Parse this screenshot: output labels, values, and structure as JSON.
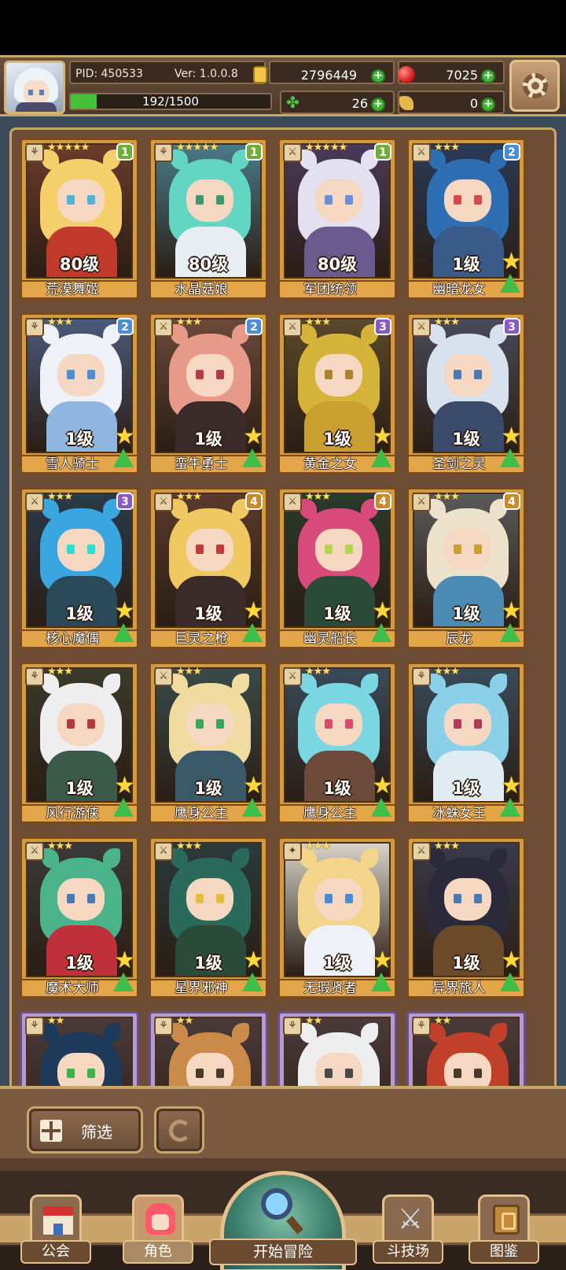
{
  "header": {
    "pid": "PID: 450533",
    "version": "Ver: 1.0.0.8",
    "gold": "2796449",
    "gems": "7025",
    "stamina": "192/1500",
    "stamina_fraction": 0.128,
    "clovers": "26",
    "scrolls": "0",
    "colors": {
      "panel": "#3a2a1f",
      "accent": "#c9a56b",
      "plus": "#45b43a"
    }
  },
  "heroes": [
    {
      "name": "荒漠舞姬",
      "level": "80级",
      "stars": "★★★★★",
      "rank": "1",
      "rank_color": "#6fae3a",
      "hair": "#f4cf6a",
      "eyes": "#4fb2d6",
      "outfit": "#c0392b",
      "bg": "#6b3b2a",
      "slot": "⚘",
      "show_up": false
    },
    {
      "name": "水晶菇娘",
      "level": "80级",
      "stars": "★★★★★",
      "rank": "1",
      "rank_color": "#6fae3a",
      "hair": "#62d6c2",
      "eyes": "#3c9a6a",
      "outfit": "#e6eef2",
      "bg": "#4a7a8a",
      "slot": "⚘",
      "show_up": false
    },
    {
      "name": "军团统领",
      "level": "80级",
      "stars": "★★★★★",
      "rank": "1",
      "rank_color": "#6fae3a",
      "hair": "#e3e0f0",
      "eyes": "#6b8fd6",
      "outfit": "#6b5a8e",
      "bg": "#4a3a5a",
      "slot": "⚔",
      "show_up": false
    },
    {
      "name": "幽暗龙女",
      "level": "1级",
      "stars": "★★★",
      "rank": "2",
      "rank_color": "#4a8fd6",
      "hair": "#2e6fb3",
      "eyes": "#d64a4a",
      "outfit": "#3a5a8a",
      "bg": "#2a3a5a",
      "slot": "⚔",
      "show_up": true
    },
    {
      "name": "雪人骑士",
      "level": "1级",
      "stars": "★★★",
      "rank": "2",
      "rank_color": "#4a8fd6",
      "hair": "#eef2f8",
      "eyes": "#4a8fd6",
      "outfit": "#8fb6e0",
      "bg": "#4a5a7a",
      "slot": "⚘",
      "show_up": true
    },
    {
      "name": "蛮牛勇士",
      "level": "1级",
      "stars": "★★★",
      "rank": "2",
      "rank_color": "#4a8fd6",
      "hair": "#e89a8a",
      "eyes": "#b33a4a",
      "outfit": "#3a2a2a",
      "bg": "#6b4a3a",
      "slot": "⚔",
      "show_up": true
    },
    {
      "name": "黄金之女",
      "level": "1级",
      "stars": "★★★",
      "rank": "3",
      "rank_color": "#8a5ac0",
      "hair": "#d6b43a",
      "eyes": "#a8842a",
      "outfit": "#c9a030",
      "bg": "#5a4a2a",
      "slot": "⚔",
      "show_up": true
    },
    {
      "name": "圣剑之灵",
      "level": "1级",
      "stars": "★★★",
      "rank": "3",
      "rank_color": "#8a5ac0",
      "hair": "#d8e2ee",
      "eyes": "#4a7ab3",
      "outfit": "#3a4a6a",
      "bg": "#4a4a5a",
      "slot": "⚔",
      "show_up": true
    },
    {
      "name": "核心魔偶",
      "level": "1级",
      "stars": "★★★",
      "rank": "3",
      "rank_color": "#8a5ac0",
      "hair": "#3aa6e0",
      "eyes": "#2ae0d6",
      "outfit": "#2a4a5a",
      "bg": "#2a3a4a",
      "slot": "⚔",
      "show_up": true
    },
    {
      "name": "巨灵之枪",
      "level": "1级",
      "stars": "★★★",
      "rank": "4",
      "rank_color": "#c98a2a",
      "hair": "#f0c862",
      "eyes": "#c03a3a",
      "outfit": "#3a2a2a",
      "bg": "#5a3a2a",
      "slot": "⚔",
      "show_up": true
    },
    {
      "name": "幽灵船长",
      "level": "1级",
      "stars": "★★★",
      "rank": "4",
      "rank_color": "#c98a2a",
      "hair": "#d84a7a",
      "eyes": "#b3d64a",
      "outfit": "#2a4a3a",
      "bg": "#2a3a2a",
      "slot": "⚔",
      "show_up": true
    },
    {
      "name": "辰龙",
      "level": "1级",
      "stars": "★★★",
      "rank": "4",
      "rank_color": "#c98a2a",
      "hair": "#ece2cc",
      "eyes": "#c9a030",
      "outfit": "#4a8ab3",
      "bg": "#5a5a5a",
      "slot": "⚔",
      "show_up": true
    },
    {
      "name": "风行游侠",
      "level": "1级",
      "stars": "★★★",
      "rank": "",
      "rank_color": "",
      "hair": "#eeeeee",
      "eyes": "#b33a3a",
      "outfit": "#3a5a4a",
      "bg": "#3a3a2a",
      "slot": "⚘",
      "show_up": true
    },
    {
      "name": "鹰身公主",
      "level": "1级",
      "stars": "★★★",
      "rank": "",
      "rank_color": "",
      "hair": "#f0dca0",
      "eyes": "#3aa65a",
      "outfit": "#3a5a6a",
      "bg": "#3a4a4a",
      "slot": "⚔",
      "show_up": true
    },
    {
      "name": "鹰身公主",
      "level": "1级",
      "stars": "★★★",
      "rank": "",
      "rank_color": "",
      "hair": "#7ad6e0",
      "eyes": "#d64a6a",
      "outfit": "#6b4a3a",
      "bg": "#3a4a5a",
      "slot": "⚔",
      "show_up": true
    },
    {
      "name": "冰蛛女王",
      "level": "1级",
      "stars": "★★★",
      "rank": "",
      "rank_color": "",
      "hair": "#8ad0e8",
      "eyes": "#b33a5a",
      "outfit": "#e0ecf2",
      "bg": "#3a4a5a",
      "slot": "⚘",
      "show_up": true
    },
    {
      "name": "魔术大师",
      "level": "1级",
      "stars": "★★★",
      "rank": "",
      "rank_color": "",
      "hair": "#4ab38a",
      "eyes": "#4a7ab3",
      "outfit": "#c0303a",
      "bg": "#3a3a3a",
      "slot": "⚔",
      "show_up": true
    },
    {
      "name": "星界邪神",
      "level": "1级",
      "stars": "★★★",
      "rank": "",
      "rank_color": "",
      "hair": "#2a6a5a",
      "eyes": "#e0c03a",
      "outfit": "#2a4a3a",
      "bg": "#2a3a3a",
      "slot": "⚔",
      "show_up": true
    },
    {
      "name": "无瑕贤者",
      "level": "1级",
      "stars": "★★★",
      "rank": "",
      "rank_color": "",
      "hair": "#f2d48a",
      "eyes": "#4a8ad6",
      "outfit": "#eef2f8",
      "bg": "#d8d2c8",
      "slot": "✦",
      "show_up": true
    },
    {
      "name": "异界旅人",
      "level": "1级",
      "stars": "★★★",
      "rank": "",
      "rank_color": "",
      "hair": "#2a2a3a",
      "eyes": "#4a7ab3",
      "outfit": "#6b4a2a",
      "bg": "#3a3a4a",
      "slot": "⚔",
      "show_up": true
    },
    {
      "name": "",
      "level": "",
      "stars": "★★",
      "rank": "",
      "rank_color": "",
      "hair": "#1e3a5a",
      "eyes": "#3ab34a",
      "outfit": "#3a3a3a",
      "bg": "#4a3a3a",
      "slot": "⚘",
      "show_up": false,
      "purple": true
    },
    {
      "name": "",
      "level": "",
      "stars": "★★",
      "rank": "",
      "rank_color": "",
      "hair": "#c98a4a",
      "eyes": "#4a3a2a",
      "outfit": "#3a3a3a",
      "bg": "#4a3a3a",
      "slot": "⚘",
      "show_up": false,
      "purple": true
    },
    {
      "name": "",
      "level": "",
      "stars": "★★",
      "rank": "",
      "rank_color": "",
      "hair": "#eeeeee",
      "eyes": "#4a4a4a",
      "outfit": "#3a3a3a",
      "bg": "#4a3a3a",
      "slot": "⚘",
      "show_up": false,
      "purple": true
    },
    {
      "name": "",
      "level": "",
      "stars": "★★",
      "rank": "",
      "rank_color": "",
      "hair": "#c0402a",
      "eyes": "#4a3a2a",
      "outfit": "#3a3a3a",
      "bg": "#4a3a3a",
      "slot": "⚘",
      "show_up": false,
      "purple": true
    }
  ],
  "filter": {
    "label": "筛选"
  },
  "nav": {
    "guild": "公会",
    "role": "角色",
    "adventure": "开始冒险",
    "arena": "斗技场",
    "codex": "图鉴"
  }
}
